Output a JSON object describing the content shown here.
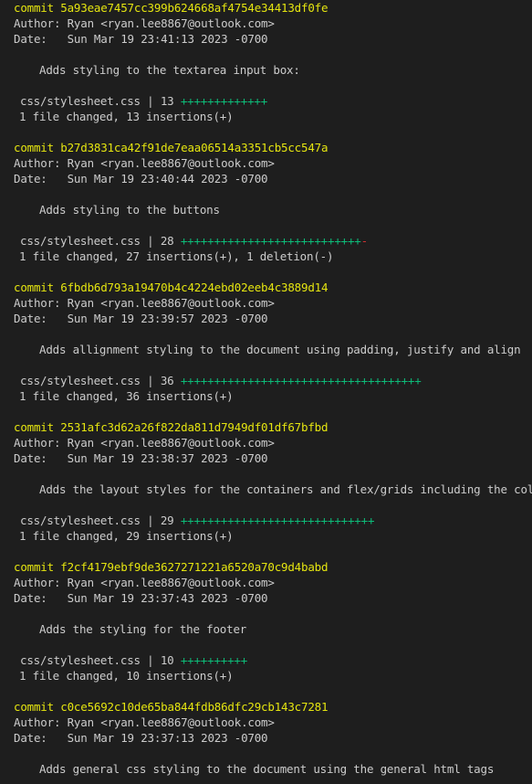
{
  "labels": {
    "commit_prefix": "commit ",
    "author_prefix": "Author: ",
    "date_prefix": "Date:   "
  },
  "colors": {
    "background": "#1e1e1e",
    "text": "#cccccc",
    "commit_hash": "#e5e510",
    "insertions": "#0dbc79",
    "deletions": "#cd3131"
  },
  "commits": [
    {
      "hash": "5a93eae7457cc399b624668af4754e34413df0fe",
      "author": "Ryan <ryan.lee8867@outlook.com>",
      "date": "Sun Mar 19 23:41:13 2023 -0700",
      "message": "Adds styling to the textarea input box:",
      "stat_prefix": "css/stylesheet.css | 13 ",
      "insertions": 13,
      "deletions": 0,
      "summary": "1 file changed, 13 insertions(+)"
    },
    {
      "hash": "b27d3831ca42f91de7eaa06514a3351cb5cc547a",
      "author": "Ryan <ryan.lee8867@outlook.com>",
      "date": "Sun Mar 19 23:40:44 2023 -0700",
      "message": "Adds styling to the buttons",
      "stat_prefix": "css/stylesheet.css | 28 ",
      "insertions": 27,
      "deletions": 1,
      "summary": "1 file changed, 27 insertions(+), 1 deletion(-)"
    },
    {
      "hash": "6fbdb6d793a19470b4c4224ebd02eeb4c3889d14",
      "author": "Ryan <ryan.lee8867@outlook.com>",
      "date": "Sun Mar 19 23:39:57 2023 -0700",
      "message": "Adds allignment styling to the document using padding, justify and align",
      "stat_prefix": "css/stylesheet.css | 36 ",
      "insertions": 36,
      "deletions": 0,
      "summary": "1 file changed, 36 insertions(+)"
    },
    {
      "hash": "2531afc3d62a26f822da811d7949df01df67bfbd",
      "author": "Ryan <ryan.lee8867@outlook.com>",
      "date": "Sun Mar 19 23:38:37 2023 -0700",
      "message": "Adds the layout styles for the containers and flex/grids including the color",
      "stat_prefix": "css/stylesheet.css | 29 ",
      "insertions": 29,
      "deletions": 0,
      "summary": "1 file changed, 29 insertions(+)"
    },
    {
      "hash": "f2cf4179ebf9de3627271221a6520a70c9d4babd",
      "author": "Ryan <ryan.lee8867@outlook.com>",
      "date": "Sun Mar 19 23:37:43 2023 -0700",
      "message": "Adds the styling for the footer",
      "stat_prefix": "css/stylesheet.css | 10 ",
      "insertions": 10,
      "deletions": 0,
      "summary": "1 file changed, 10 insertions(+)"
    },
    {
      "hash": "c0ce5692c10de65ba844fdb86dfc29cb143c7281",
      "author": "Ryan <ryan.lee8867@outlook.com>",
      "date": "Sun Mar 19 23:37:13 2023 -0700",
      "message": "Adds general css styling to the document using the general html tags"
    }
  ]
}
